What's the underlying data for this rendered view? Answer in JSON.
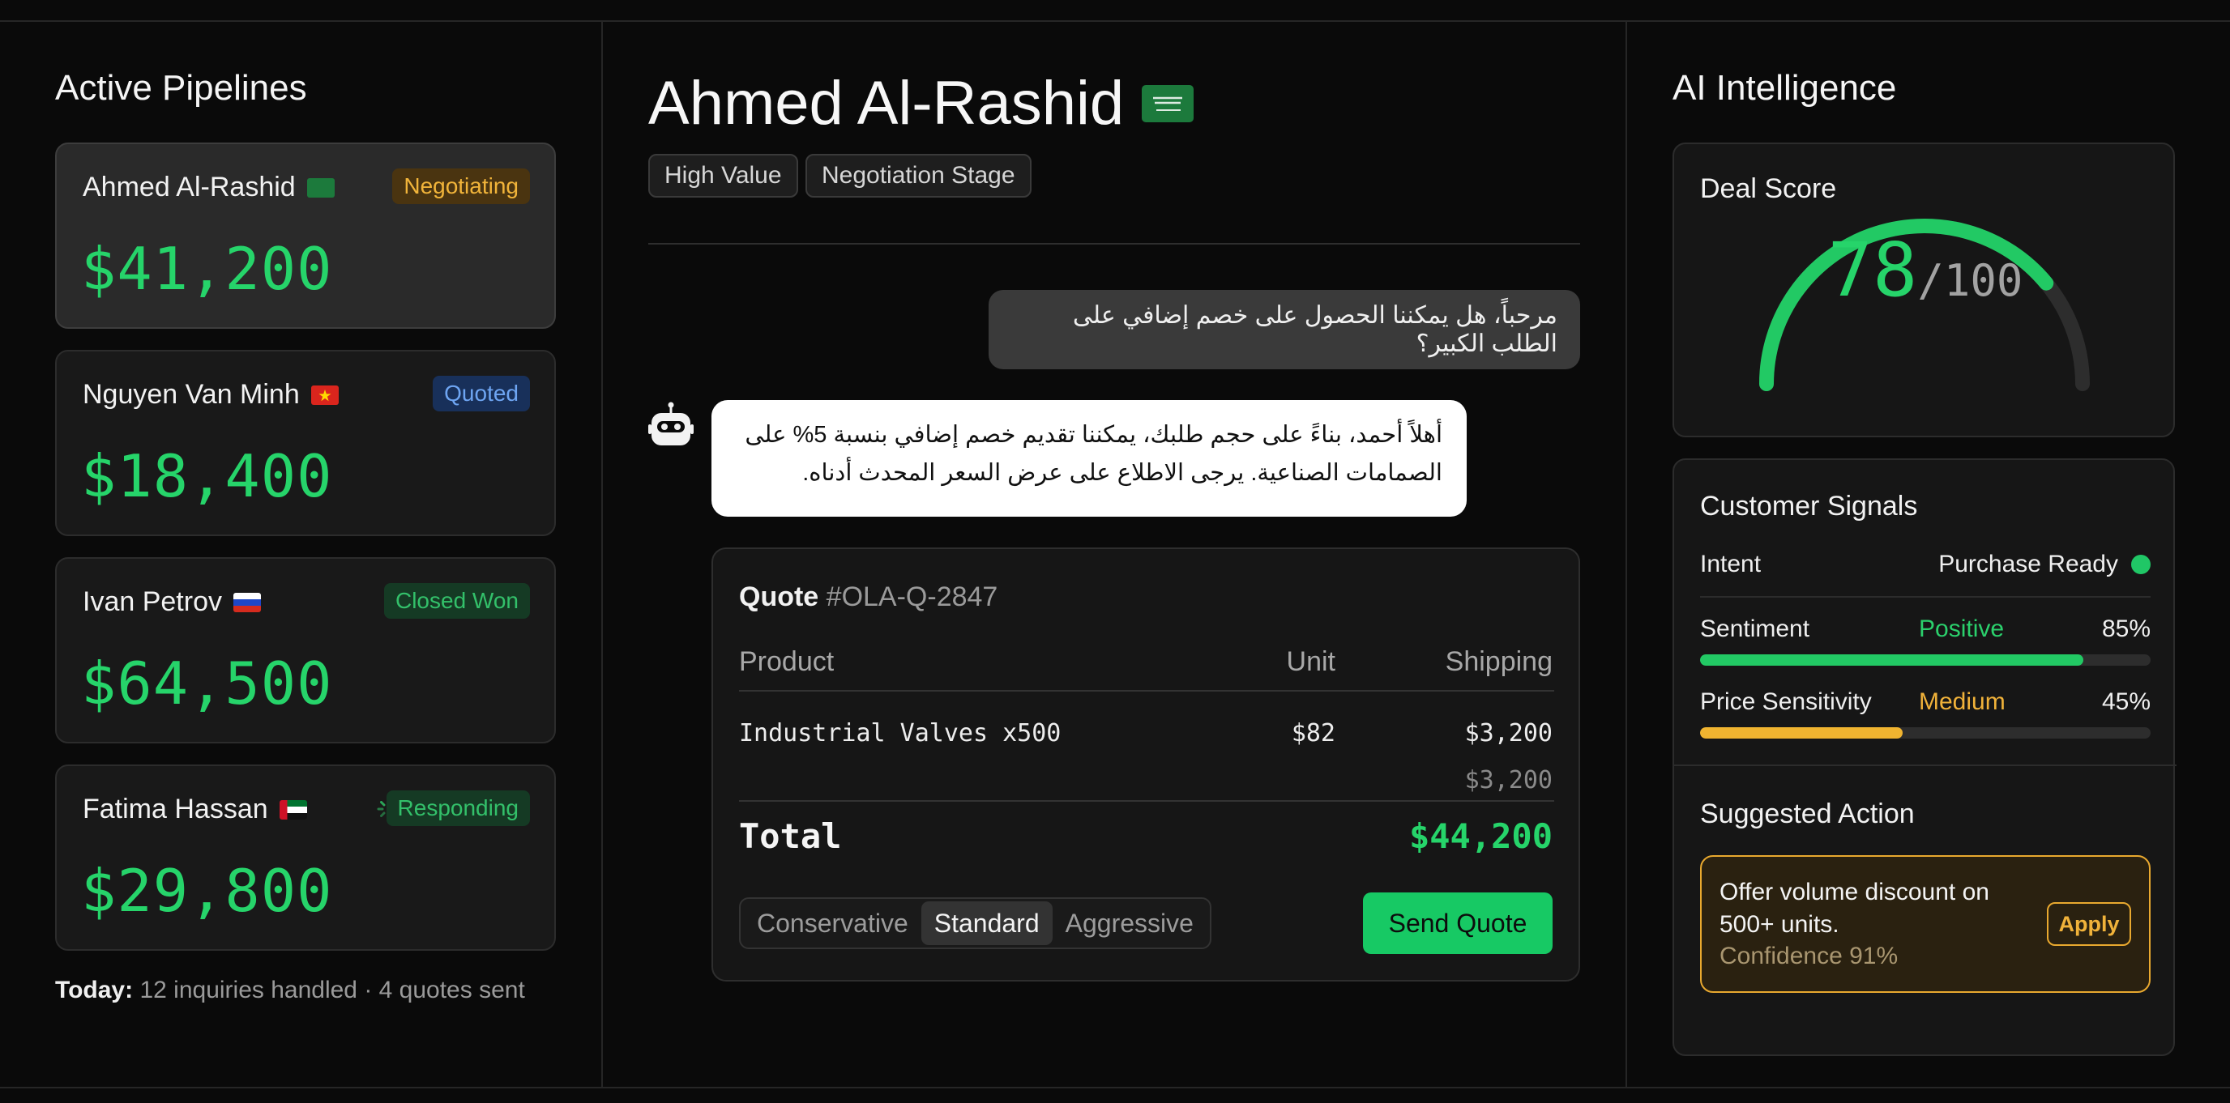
{
  "pipelines": {
    "title": "Active Pipelines",
    "items": [
      {
        "name": "Ahmed Al-Rashid",
        "flag": "saudi-arabia",
        "status": "Negotiating",
        "amount": "$41,200"
      },
      {
        "name": "Nguyen Van Minh",
        "flag": "vietnam",
        "status": "Quoted",
        "amount": "$18,400"
      },
      {
        "name": "Ivan Petrov",
        "flag": "russia",
        "status": "Closed Won",
        "amount": "$64,500"
      },
      {
        "name": "Fatima Hassan",
        "flag": "uae",
        "status": "Responding",
        "amount": "$29,800"
      }
    ],
    "today_label": "Today:",
    "today_text": "12 inquiries handled · 4 quotes sent"
  },
  "conversation": {
    "customer_name": "Ahmed Al-Rashid",
    "customer_flag": "saudi-arabia",
    "tags": [
      "High Value",
      "Negotiation Stage"
    ],
    "user_message": "مرحباً، هل يمكننا الحصول على خصم إضافي على الطلب الكبير؟",
    "ai_message": "أهلاً أحمد، بناءً على حجم طلبك، يمكننا تقديم خصم إضافي بنسبة 5% على الصمامات الصناعية. يرجى الاطلاع على عرض السعر المحدث أدناه.",
    "quote": {
      "label": "Quote",
      "number": "#OLA-Q-2847",
      "columns": [
        "Product",
        "Unit",
        "Shipping"
      ],
      "rows": [
        {
          "product": "Industrial Valves x500",
          "unit": "$82",
          "shipping": "$3,200"
        }
      ],
      "sub_shipping": "$3,200",
      "total_label": "Total",
      "total_value": "$44,200",
      "strategies": [
        "Conservative",
        "Standard",
        "Aggressive"
      ],
      "selected_strategy": "Standard",
      "send_label": "Send Quote"
    }
  },
  "intelligence": {
    "title": "AI Intelligence",
    "deal_score": {
      "title": "Deal Score",
      "score": 78,
      "max": "/100"
    },
    "signals": {
      "title": "Customer Signals",
      "intent_label": "Intent",
      "intent_value": "Purchase Ready",
      "sentiment_label": "Sentiment",
      "sentiment_value": "Positive",
      "sentiment_pct": "85%",
      "sentiment_fraction": 0.85,
      "price_label": "Price Sensitivity",
      "price_value": "Medium",
      "price_pct": "45%",
      "price_fraction": 0.45
    },
    "action": {
      "title": "Suggested Action",
      "text": "Offer volume discount on 500+ units.",
      "confidence": "Confidence 91%",
      "apply_label": "Apply"
    }
  },
  "colors": {
    "accent_green": "#26d46a",
    "amber": "#e9a92f",
    "blue": "#6ea5f2"
  }
}
